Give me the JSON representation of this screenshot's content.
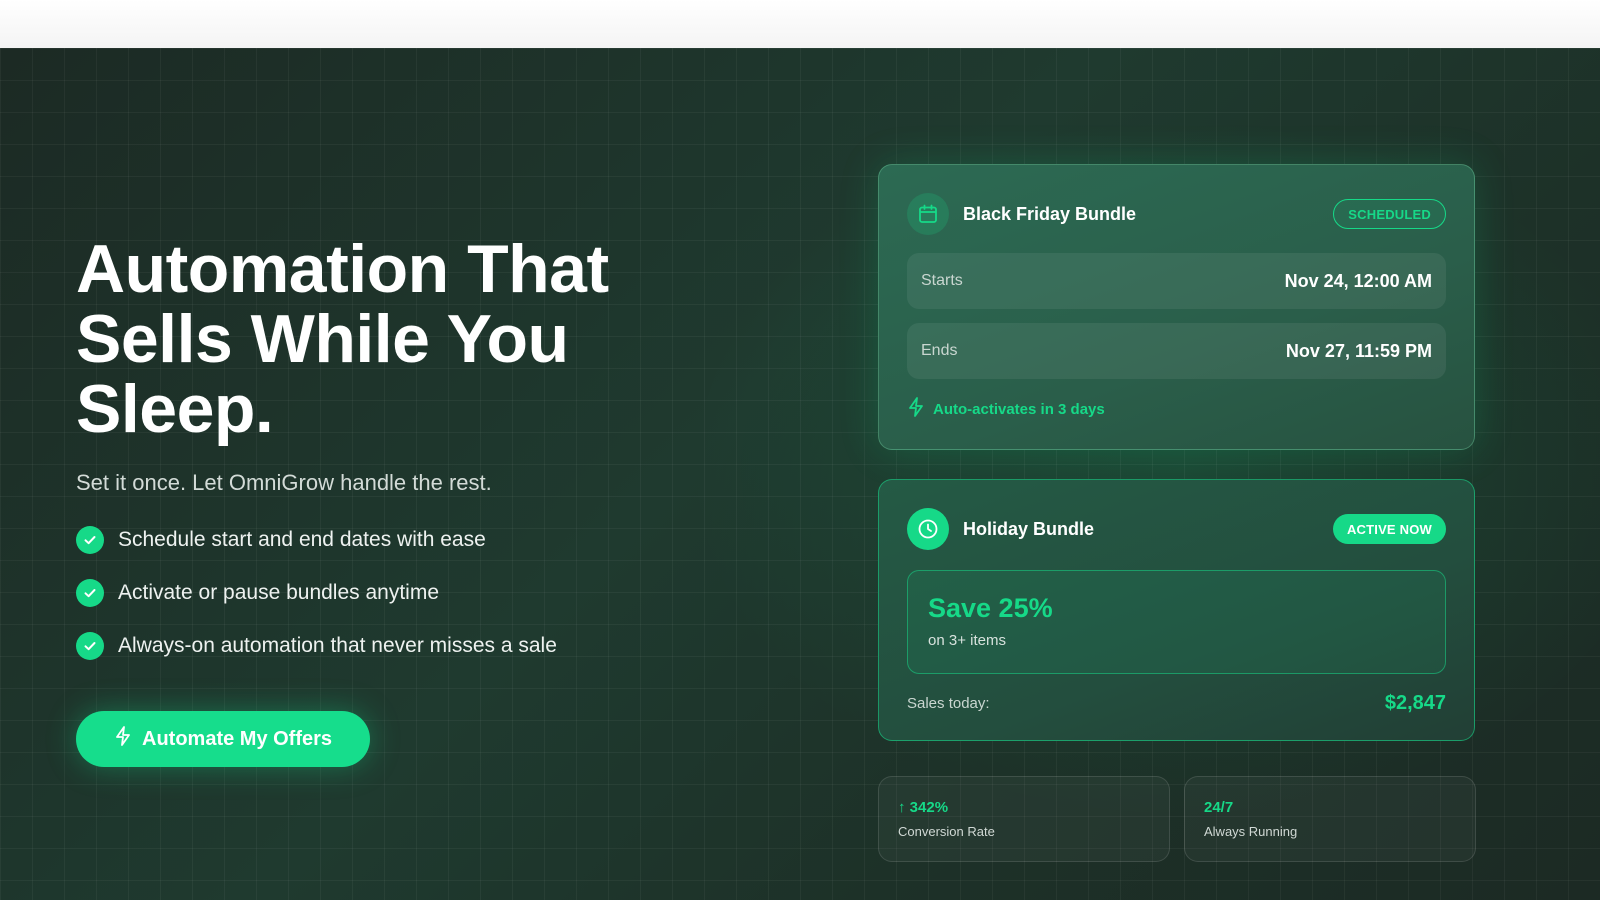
{
  "hero": {
    "headline": [
      "Automation That",
      "Sells While You",
      "Sleep."
    ],
    "subline": "Set it once. Let OmniGrow handle the rest.",
    "features": [
      "Schedule start and end dates with ease",
      "Activate or pause bundles anytime",
      "Always-on automation that never misses a sale"
    ],
    "cta_label": "Automate My Offers"
  },
  "cards": {
    "black_friday": {
      "title": "Black Friday Bundle",
      "badge": "SCHEDULED",
      "starts_label": "Starts",
      "starts_value": "Nov 24, 12:00 AM",
      "ends_label": "Ends",
      "ends_value": "Nov 27, 11:59 PM",
      "note": "Auto-activates in 3 days",
      "icon": "calendar-icon"
    },
    "holiday": {
      "title": "Holiday Bundle",
      "badge": "ACTIVE NOW",
      "save_title": "Save 25%",
      "save_sub": "on 3+ items",
      "sales_label": "Sales today:",
      "sales_value": "$2,847",
      "icon": "clock-icon"
    }
  },
  "stats": [
    {
      "value": "↑ 342%",
      "label": "Conversion Rate"
    },
    {
      "value": "24/7",
      "label": "Always Running"
    }
  ],
  "colors": {
    "accent": "#16d988",
    "background": "#1f3a2f",
    "text": "#ffffff"
  }
}
